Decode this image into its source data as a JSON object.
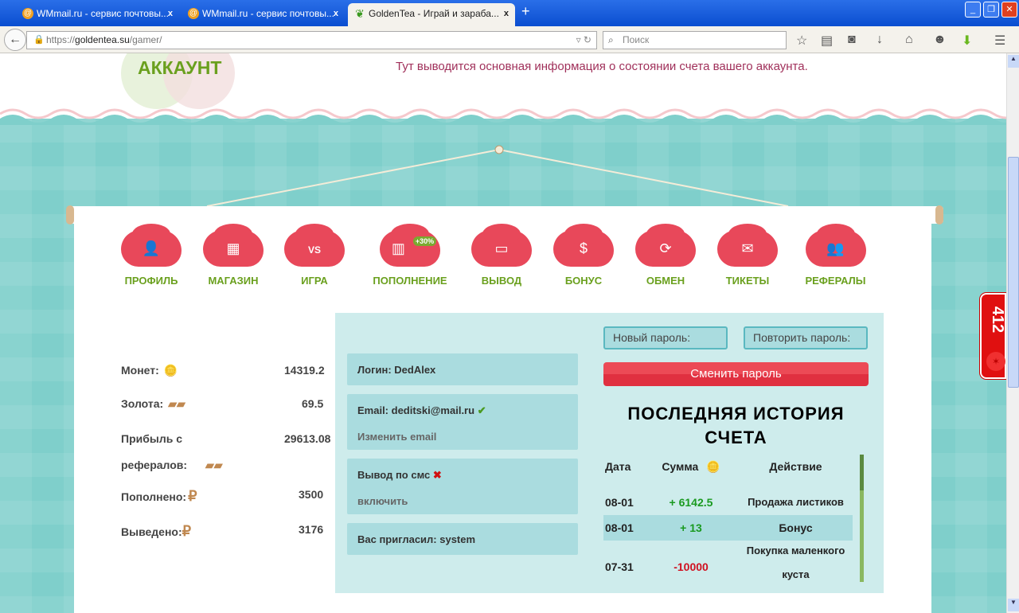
{
  "browser": {
    "tabs": [
      {
        "title": "WMmail.ru - сервис почтовы..."
      },
      {
        "title": "WMmail.ru - сервис почтовы..."
      },
      {
        "title": "GoldenTea - Играй и зараба..."
      }
    ],
    "url_prefix": "https://",
    "url_domain": "goldentea.su",
    "url_path": "/gamer/",
    "search_placeholder": "Поиск"
  },
  "header": {
    "logo": "АККАУНТ",
    "subtitle": "Тут выводится основная информация о состоянии счета вашего аккаунта."
  },
  "menu": [
    {
      "label": "ПРОФИЛЬ",
      "icon": "profile-icon"
    },
    {
      "label": "МАГАЗИН",
      "icon": "shop-icon"
    },
    {
      "label": "ИГРА",
      "icon": "vs-icon"
    },
    {
      "label": "ПОПОЛНЕНИЕ",
      "icon": "terminal-icon",
      "badge": "+30%"
    },
    {
      "label": "ВЫВОД",
      "icon": "wallet-icon"
    },
    {
      "label": "БОНУС",
      "icon": "dollar-icon"
    },
    {
      "label": "ОБМЕН",
      "icon": "exchange-icon"
    },
    {
      "label": "ТИКЕТЫ",
      "icon": "envelope-icon"
    },
    {
      "label": "РЕФЕРАЛЫ",
      "icon": "users-icon"
    }
  ],
  "stats": [
    {
      "label": "Монет:",
      "value": "14319.2"
    },
    {
      "label": "Золота:",
      "value": "69.5"
    },
    {
      "label": "Прибыль с рефералов:",
      "value": "29613.08"
    },
    {
      "label": "Пополнено:",
      "value": "3500"
    },
    {
      "label": "Выведено:",
      "value": "3176"
    }
  ],
  "account": {
    "login": "Логин: DedAlex",
    "email": "Email: deditski@mail.ru",
    "change_email": "Изменить email",
    "sms": "Вывод по смс",
    "sms_enable": "включить",
    "invited": "Вас пригласил: system"
  },
  "password": {
    "new_placeholder": "Новый пароль:",
    "repeat_placeholder": "Повторить пароль:",
    "change_button": "Сменить пароль"
  },
  "history": {
    "title": "ПОСЛЕДНЯЯ ИСТОРИЯ СЧЕТА",
    "headers": [
      "Дата",
      "Сумма",
      "Действие"
    ],
    "rows": [
      {
        "date": "08-01",
        "amount": "+ 6142.5",
        "action": "Продажа листиков"
      },
      {
        "date": "08-01",
        "amount": "+ 13",
        "action": "Бонус"
      },
      {
        "date": "07-31",
        "amount": "-10000",
        "action": "Покупка маленкого куста"
      }
    ]
  },
  "widget": {
    "count": "412"
  }
}
